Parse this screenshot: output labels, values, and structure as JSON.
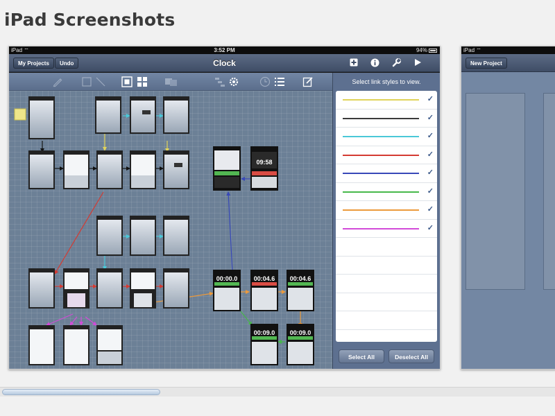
{
  "page": {
    "title": "iPad Screenshots"
  },
  "screenshot1": {
    "status": {
      "carrier": "iPad",
      "time": "3:52 PM",
      "battery": "94%"
    },
    "nav": {
      "title": "Clock",
      "my_projects": "My Projects",
      "undo": "Undo"
    },
    "sidebar": {
      "header": "Select link styles to view.",
      "select_all": "Select All",
      "deselect_all": "Deselect All",
      "styles": [
        {
          "color": "#e0d35a",
          "checked": "✓"
        },
        {
          "color": "#3a3a3a",
          "checked": "✓"
        },
        {
          "color": "#4ac8d8",
          "checked": "✓"
        },
        {
          "color": "#d43a32",
          "checked": "✓"
        },
        {
          "color": "#3848b8",
          "checked": "✓"
        },
        {
          "color": "#46b84a",
          "checked": "✓"
        },
        {
          "color": "#ec9a3c",
          "checked": "✓"
        },
        {
          "color": "#d24ad8",
          "checked": "✓"
        }
      ]
    },
    "canvas": {
      "timers": [
        "09:58",
        "00:00.0",
        "00:04.6",
        "00:04.6",
        "00:09.0",
        "00:09.0"
      ]
    }
  },
  "screenshot2": {
    "status": {
      "carrier": "iPad"
    },
    "nav": {
      "new_project": "New Project"
    }
  },
  "colors": {
    "canvas": "#6c8096",
    "navbar": "#4a5873",
    "panel": "#5d7090",
    "accent": "#3c5a8a"
  }
}
